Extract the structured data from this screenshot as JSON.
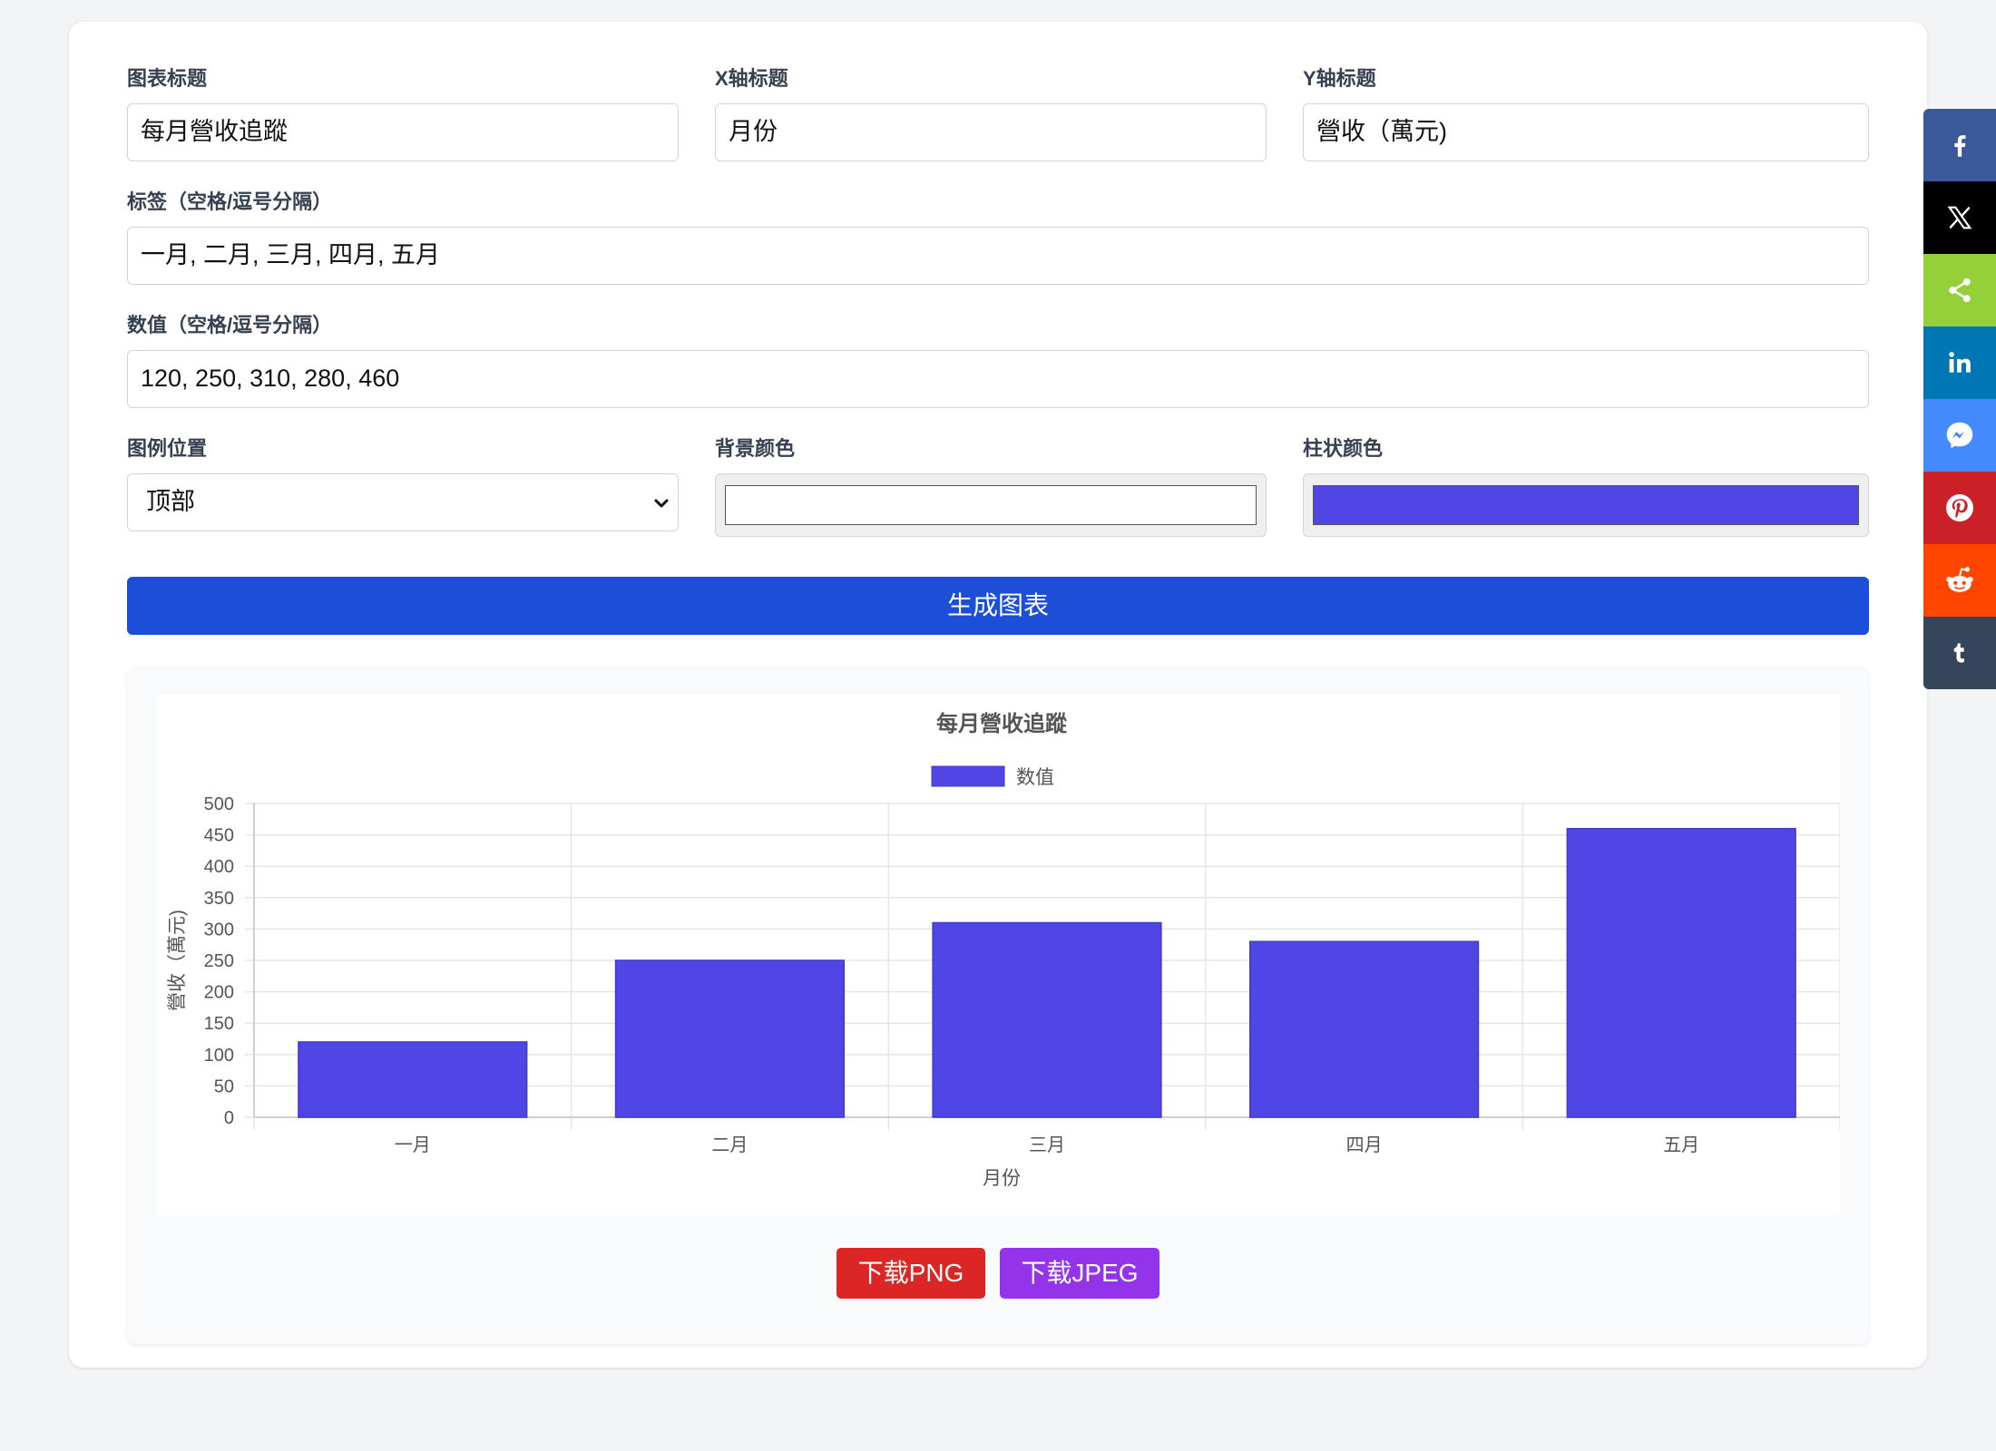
{
  "form": {
    "chart_title_label": "图表标题",
    "chart_title_value": "每月營收追蹤",
    "x_title_label": "X轴标题",
    "x_title_value": "月份",
    "y_title_label": "Y轴标题",
    "y_title_value": "營收（萬元)",
    "labels_label": "标签（空格/逗号分隔）",
    "labels_value": "一月, 二月, 三月, 四月, 五月",
    "values_label": "数值（空格/逗号分隔）",
    "values_value": "120, 250, 310, 280, 460",
    "legend_pos_label": "图例位置",
    "legend_pos_value": "顶部",
    "bg_color_label": "背景颜色",
    "bg_color_value": "#ffffff",
    "bar_color_label": "柱状颜色",
    "bar_color_value": "#4f46e5",
    "generate_label": "生成图表"
  },
  "downloads": {
    "png_label": "下载PNG",
    "png_color": "#dc2626",
    "jpeg_label": "下载JPEG",
    "jpeg_color": "#9333ea"
  },
  "share": [
    {
      "name": "facebook-icon",
      "color": "#3b5998"
    },
    {
      "name": "x-icon",
      "color": "#000000"
    },
    {
      "name": "share-icon",
      "color": "#95d03a"
    },
    {
      "name": "linkedin-icon",
      "color": "#0077b5"
    },
    {
      "name": "messenger-icon",
      "color": "#448aff"
    },
    {
      "name": "pinterest-icon",
      "color": "#cb2027"
    },
    {
      "name": "reddit-icon",
      "color": "#ff4500"
    },
    {
      "name": "tumblr-icon",
      "color": "#35465c"
    }
  ],
  "chart_data": {
    "type": "bar",
    "title": "每月營收追蹤",
    "xlabel": "月份",
    "ylabel": "營收（萬元)",
    "categories": [
      "一月",
      "二月",
      "三月",
      "四月",
      "五月"
    ],
    "series": [
      {
        "name": "数值",
        "values": [
          120,
          250,
          310,
          280,
          460
        ]
      }
    ],
    "ylim": [
      0,
      500
    ],
    "yticks": [
      0,
      50,
      100,
      150,
      200,
      250,
      300,
      350,
      400,
      450,
      500
    ],
    "grid": true,
    "legend_position": "top",
    "bar_color": "#4f46e5"
  }
}
